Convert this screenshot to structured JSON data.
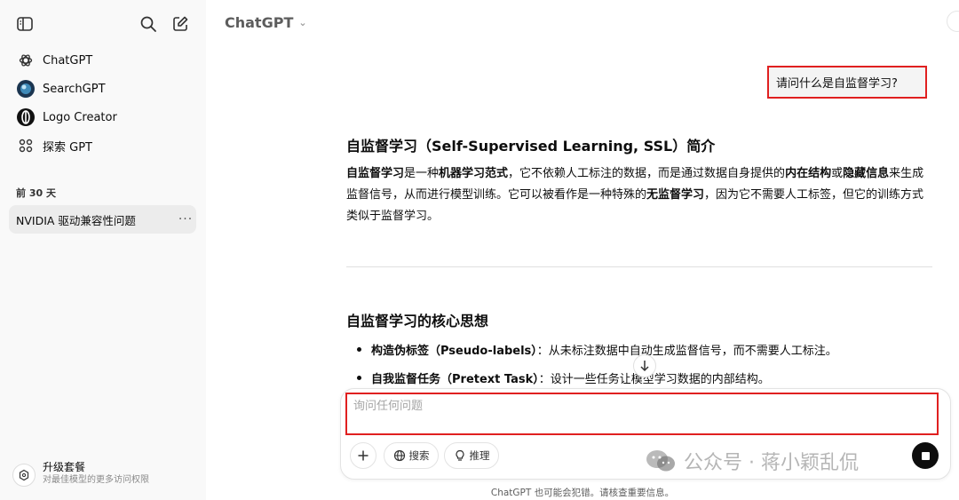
{
  "sidebar": {
    "items": [
      {
        "label": "ChatGPT",
        "icon": "openai-logo-icon"
      },
      {
        "label": "SearchGPT",
        "icon": "searchgpt-avatar-icon"
      },
      {
        "label": "Logo Creator",
        "icon": "logo-creator-avatar-icon"
      },
      {
        "label": "探索 GPT",
        "icon": "grid-icon"
      }
    ],
    "section_label": "前 30 天",
    "chat_title": "NVIDIA 驱动兼容性问题",
    "more_label": "···",
    "upgrade_title": "升级套餐",
    "upgrade_subtitle": "对最佳模型的更多访问权限"
  },
  "header": {
    "model_name": "ChatGPT",
    "chevron": "⌄"
  },
  "conversation": {
    "user_message": "请问什么是自监督学习?",
    "heading1": "自监督学习（Self-Supervised Learning, SSL）简介",
    "para_parts": [
      "自监督学习",
      "是一种",
      "机器学习范式",
      "，它不依赖人工标注的数据，而是通过数据自身提供的",
      "内在结构",
      "或",
      "隐藏信息",
      "来生成监督信号，从而进行模型训练。它可以被看作是一种特殊的",
      "无监督学习",
      "，因为它不需要人工标签，但它的训练方式类似于监督学习。"
    ],
    "heading2": "自监督学习的核心思想",
    "bullets": [
      {
        "bold": "构造伪标签（Pseudo-labels）",
        "text": "：从未标注数据中自动生成监督信号，而不需要人工标注。"
      },
      {
        "bold": "自我监督任务（Pretext Task）",
        "text": "：设计一些任务让模型学习数据的内部结构。"
      }
    ]
  },
  "composer": {
    "placeholder": "询问任何问题",
    "search_label": "搜索",
    "reason_label": "推理"
  },
  "watermark": "公众号 · 蒋小颖乱侃",
  "disclaimer": "ChatGPT 也可能会犯错。请核查重要信息。",
  "colors": {
    "highlight_border": "#e02020",
    "sidebar_bg": "#f9f9f9",
    "selected_chat_bg": "#ececec"
  }
}
